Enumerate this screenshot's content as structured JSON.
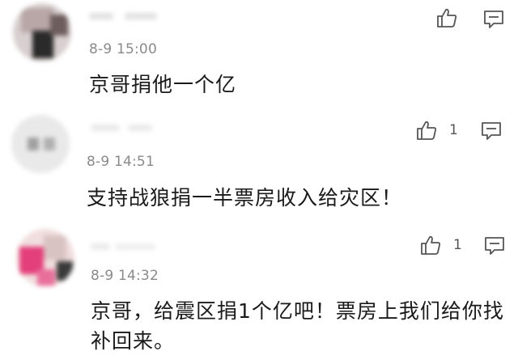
{
  "comments": [
    {
      "time": "8-9 15:00",
      "text": "京哥捐他一个亿",
      "likes": "",
      "icons": {
        "like": "thumbs-up-icon",
        "reply": "comment-icon"
      }
    },
    {
      "time": "8-9 14:51",
      "text": "支持战狼捐一半票房收入给灾区！",
      "likes": "1",
      "icons": {
        "like": "thumbs-up-icon",
        "reply": "comment-icon"
      }
    },
    {
      "time": "8-9 14:32",
      "text": "京哥，给震区捐1个亿吧！票房上我们给你找补回来。",
      "likes": "1",
      "icons": {
        "like": "thumbs-up-icon",
        "reply": "comment-icon"
      }
    }
  ],
  "colors": {
    "text": "#1a1a1a",
    "meta": "#8a8a8a",
    "icon": "#555555"
  }
}
